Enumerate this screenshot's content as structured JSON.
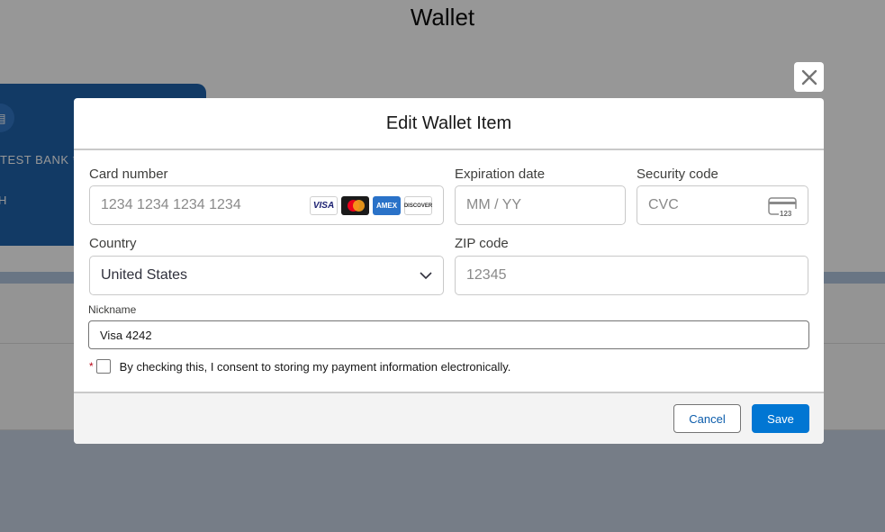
{
  "page": {
    "title": "Wallet",
    "bank_card": {
      "name": "TEST BANK **",
      "sub": "H"
    }
  },
  "modal": {
    "title": "Edit Wallet Item",
    "card_number": {
      "label": "Card number",
      "placeholder": "1234 1234 1234 1234",
      "brands": [
        "VISA",
        "mastercard-icon",
        "AMEX",
        "DISCOVER"
      ]
    },
    "expiration": {
      "label": "Expiration date",
      "placeholder": "MM / YY"
    },
    "security": {
      "label": "Security code",
      "placeholder": "CVC",
      "icon_text": "123"
    },
    "country": {
      "label": "Country",
      "value": "United States"
    },
    "zip": {
      "label": "ZIP code",
      "placeholder": "12345"
    },
    "nickname": {
      "label": "Nickname",
      "value": "Visa 4242"
    },
    "consent": {
      "required_marker": "*",
      "text": "By checking this, I consent to storing my payment information electronically."
    },
    "cancel_label": "Cancel",
    "save_label": "Save"
  },
  "colors": {
    "brand": "#0176d3",
    "card_blue": "#1b5faa",
    "required": "#ba0517"
  }
}
